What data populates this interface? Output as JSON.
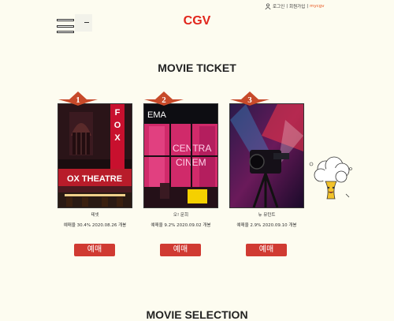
{
  "header": {
    "login": "로그인",
    "signup": "회원가입",
    "mycgv": "mycgv",
    "sep": "|",
    "logo": "CGV"
  },
  "sections": {
    "ticket_title": "MOVIE TICKET",
    "selection_title": "MOVIE SELECTION"
  },
  "movies": [
    {
      "rank": "1",
      "title": "테넷",
      "info": "예매율 30.4%  2020.08.26 개봉",
      "button": "예매"
    },
    {
      "rank": "2",
      "title": "오! 문희",
      "info": "예매율 9.2%  2020.09.02 개봉",
      "button": "예매"
    },
    {
      "rank": "3",
      "title": "뉴 뮤턴트",
      "info": "예매율 2.9%  2020.09.10 개봉",
      "button": "예매"
    }
  ],
  "poster_text": {
    "p1_marquee": "OX THEATRE",
    "p1_vertical": "FOX",
    "p2_top": "EMA",
    "p2_sign1": "CENTRA",
    "p2_sign2": "CINEM"
  },
  "colors": {
    "accent": "#e1251b",
    "button": "#d03a32",
    "rank_badge": "#c74a2a",
    "background": "#fdfcf0"
  },
  "icons": [
    "user-icon",
    "hamburger-menu-icon",
    "mascot-illustration"
  ]
}
